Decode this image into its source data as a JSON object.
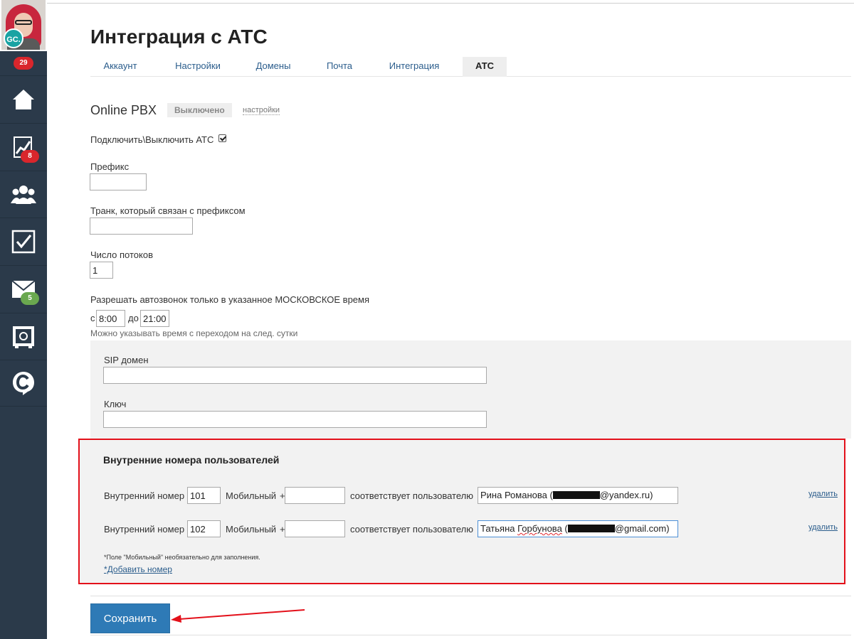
{
  "sidebar": {
    "avatar_initials": "GC.",
    "notifications_count": "29",
    "items": [
      {
        "icon": "home-icon"
      },
      {
        "icon": "chart-icon",
        "badge": "8",
        "badge_color": "#d9262c"
      },
      {
        "icon": "users-icon"
      },
      {
        "icon": "tasks-checkbox-icon"
      },
      {
        "icon": "mail-icon",
        "badge": "5",
        "badge_color": "#6aa84f"
      },
      {
        "icon": "safe-icon"
      },
      {
        "icon": "chat-c-icon"
      }
    ]
  },
  "page": {
    "title": "Интеграция с АТС"
  },
  "tabs": [
    {
      "label": "Аккаунт"
    },
    {
      "label": "Настройки"
    },
    {
      "label": "Домены"
    },
    {
      "label": "Почта"
    },
    {
      "label": "Интеграция"
    },
    {
      "label": "АТС",
      "active": true
    }
  ],
  "pbx": {
    "name": "Online PBX",
    "status": "Выключено",
    "settings_link": "настройки"
  },
  "form": {
    "enable_label": "Подключить\\Выключить АТС",
    "enable_checked": true,
    "prefix_label": "Префикс",
    "prefix_value": "",
    "trunk_label": "Транк, который связан с префиксом",
    "trunk_value": "",
    "threads_label": "Число потоков",
    "threads_value": "1",
    "time_label": "Разрешать автозвонок только в указанное МОСКОВСКОЕ время",
    "from_label": "с",
    "from_value": "8:00",
    "to_label": "до",
    "to_value": "21:00",
    "time_hint": "Можно указывать время с переходом на след. сутки",
    "sip_label": "SIP домен",
    "sip_value": "",
    "key_label": "Ключ",
    "key_value": ""
  },
  "internal": {
    "title": "Внутренние номера пользователей",
    "ext_label": "Внутренний номер",
    "mobile_label": "Мобильный",
    "plus": "+",
    "match_label": "соответствует пользователю",
    "delete_label": "удалить",
    "rows": [
      {
        "ext": "101",
        "mobile": "",
        "user_name": "Рина Романова (",
        "user_email_tail": "@yandex.ru)"
      },
      {
        "ext": "102",
        "mobile": "",
        "user_first": "Татьяна",
        "user_last": "Горбунова",
        "user_open": " (",
        "user_email_tail": "@gmail.com)"
      }
    ],
    "note": "*Поле \"Мобильный\" необязательно для заполнения.",
    "add_link": "*Добавить номер"
  },
  "actions": {
    "save_label": "Сохранить"
  }
}
